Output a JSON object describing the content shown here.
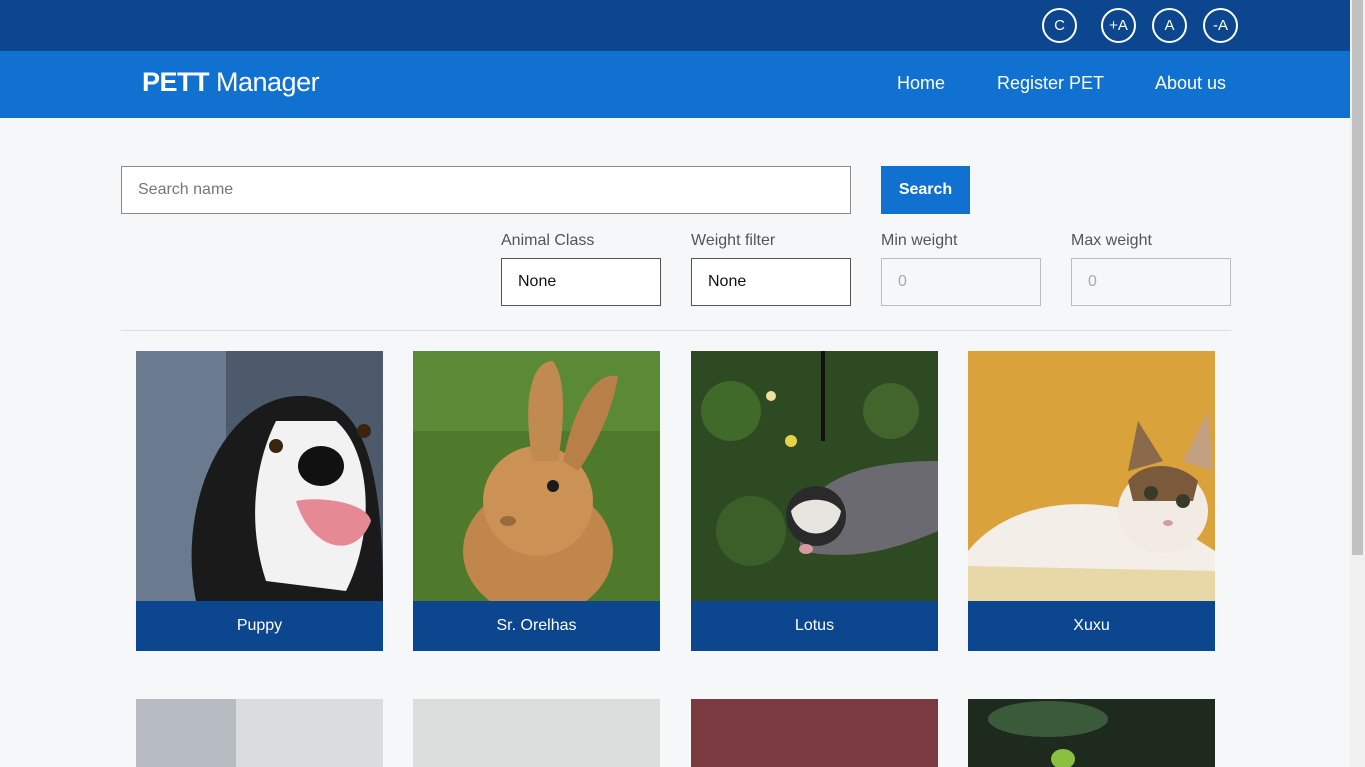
{
  "accessibility": {
    "contrast_label": "C",
    "increase_font_label": "+A",
    "default_font_label": "A",
    "decrease_font_label": "-A"
  },
  "brand": {
    "prefix": "PETT",
    "suffix": " Manager"
  },
  "nav": {
    "home": "Home",
    "register": "Register PET",
    "about": "About us"
  },
  "search": {
    "placeholder": "Search name",
    "button_label": "Search"
  },
  "filters": {
    "animal_class": {
      "label": "Animal Class",
      "value": "None"
    },
    "weight_filter": {
      "label": "Weight filter",
      "value": "None"
    },
    "min_weight": {
      "label": "Min weight",
      "value": "0"
    },
    "max_weight": {
      "label": "Max weight",
      "value": "0"
    }
  },
  "pets": [
    {
      "name": "Puppy",
      "image": "dog-photo"
    },
    {
      "name": "Sr. Orelhas",
      "image": "rabbit-photo"
    },
    {
      "name": "Lotus",
      "image": "ferret-photo"
    },
    {
      "name": "Xuxu",
      "image": "kitten-photo"
    }
  ],
  "colors": {
    "top_bar": "#0c468f",
    "nav_bar": "#1071d0",
    "card_label": "#0c468f",
    "button": "#1071d0"
  }
}
